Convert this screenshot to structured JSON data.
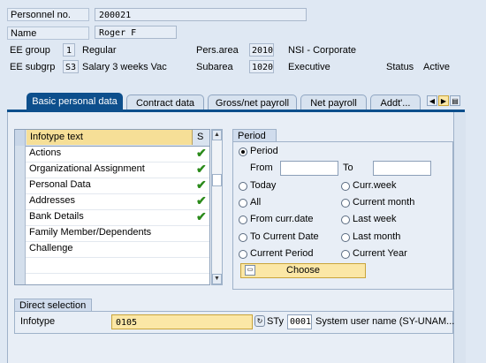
{
  "header": {
    "personnel_label": "Personnel no.",
    "personnel_value": "200021",
    "name_label": "Name",
    "name_value": "Roger F",
    "ee_group_label": "EE group",
    "ee_group_code": "1",
    "ee_group_text": "Regular",
    "ee_subgrp_label": "EE subgrp",
    "ee_subgrp_code": "S3",
    "ee_subgrp_text": "Salary 3 weeks Vac",
    "pers_area_label": "Pers.area",
    "pers_area_code": "2010",
    "pers_area_text": "NSI - Corporate",
    "subarea_label": "Subarea",
    "subarea_code": "1020",
    "subarea_text": "Executive",
    "status_label": "Status",
    "status_text": "Active"
  },
  "tabs": [
    {
      "label": "Basic personal data",
      "active": true
    },
    {
      "label": "Contract data",
      "active": false
    },
    {
      "label": "Gross/net payroll",
      "active": false
    },
    {
      "label": "Net payroll",
      "active": false
    },
    {
      "label": "Addt'...",
      "active": false
    }
  ],
  "infotype_table": {
    "header": "Infotype text",
    "header_col2": "S",
    "rows": [
      {
        "text": "Actions",
        "checked": true
      },
      {
        "text": "Organizational Assignment",
        "checked": true
      },
      {
        "text": "Personal Data",
        "checked": true
      },
      {
        "text": "Addresses",
        "checked": true
      },
      {
        "text": "Bank Details",
        "checked": true
      },
      {
        "text": "Family Member/Dependents",
        "checked": false
      },
      {
        "text": "Challenge",
        "checked": false
      },
      {
        "text": "",
        "checked": false
      },
      {
        "text": "",
        "checked": false
      }
    ]
  },
  "period": {
    "title": "Period",
    "options": {
      "period": "Period",
      "today": "Today",
      "all": "All",
      "from_curr_date": "From curr.date",
      "to_current_date": "To Current Date",
      "current_period": "Current Period",
      "curr_week": "Curr.week",
      "current_month": "Current month",
      "last_week": "Last week",
      "last_month": "Last month",
      "current_year": "Current Year"
    },
    "selected": "period",
    "from_label": "From",
    "to_label": "To",
    "from_value": "",
    "to_value": "",
    "choose_label": "Choose"
  },
  "direct_selection": {
    "title": "Direct selection",
    "infotype_label": "Infotype",
    "infotype_value": "0105",
    "sty_label": "STy",
    "sty_value": "0001",
    "sty_text": "System user name (SY-UNAM..."
  }
}
